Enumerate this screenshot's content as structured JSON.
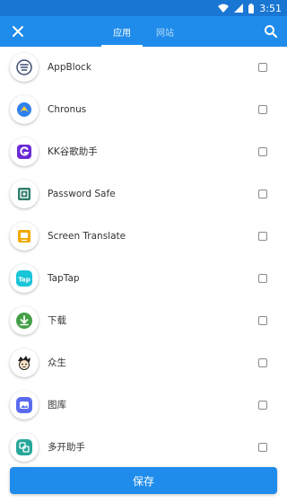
{
  "status_bar": {
    "time": "3:51",
    "icons": [
      "wifi-icon",
      "signal-icon",
      "battery-icon"
    ]
  },
  "toolbar": {
    "close_icon": "close-icon",
    "search_icon": "search-icon",
    "tabs": [
      {
        "label": "应用",
        "selected": true
      },
      {
        "label": "网站",
        "selected": false
      }
    ]
  },
  "apps": [
    {
      "name": "AppBlock",
      "icon": "appblock-icon",
      "checked": false
    },
    {
      "name": "Chronus",
      "icon": "chronus-icon",
      "checked": false
    },
    {
      "name": "KK谷歌助手",
      "icon": "kk-google-helper-icon",
      "checked": false
    },
    {
      "name": "Password Safe",
      "icon": "password-safe-icon",
      "checked": false
    },
    {
      "name": "Screen Translate",
      "icon": "screen-translate-icon",
      "checked": false
    },
    {
      "name": "TapTap",
      "icon": "taptap-icon",
      "checked": false
    },
    {
      "name": "下载",
      "icon": "download-icon",
      "checked": false
    },
    {
      "name": "众生",
      "icon": "zhongsheng-icon",
      "checked": false
    },
    {
      "name": "图库",
      "icon": "gallery-icon",
      "checked": false
    },
    {
      "name": "多开助手",
      "icon": "multi-open-icon",
      "checked": false
    }
  ],
  "save_label": "保存",
  "colors": {
    "status_bar": "#1976d2",
    "toolbar": "#1f8ceb",
    "button": "#1f8ceb"
  }
}
